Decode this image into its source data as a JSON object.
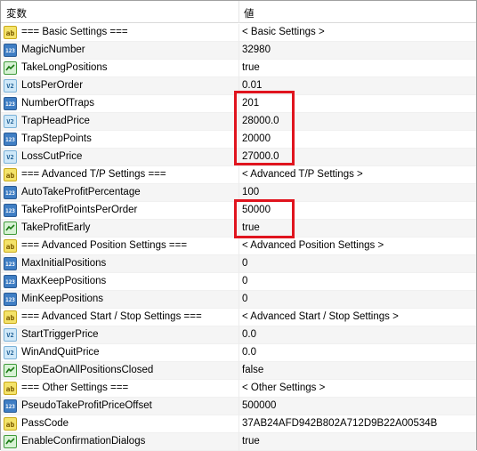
{
  "header": {
    "name_col": "変数",
    "value_col": "値"
  },
  "rows": [
    {
      "type": "ab",
      "name": "=== Basic Settings ===",
      "value": "< Basic Settings >"
    },
    {
      "type": "123",
      "name": "MagicNumber",
      "value": "32980"
    },
    {
      "type": "bool",
      "name": "TakeLongPositions",
      "value": "true"
    },
    {
      "type": "v2",
      "name": "LotsPerOrder",
      "value": "0.01"
    },
    {
      "type": "123",
      "name": "NumberOfTraps",
      "value": "201"
    },
    {
      "type": "v2",
      "name": "TrapHeadPrice",
      "value": "28000.0"
    },
    {
      "type": "123",
      "name": "TrapStepPoints",
      "value": "20000"
    },
    {
      "type": "v2",
      "name": "LossCutPrice",
      "value": "27000.0"
    },
    {
      "type": "ab",
      "name": "=== Advanced T/P Settings ===",
      "value": "< Advanced T/P Settings >"
    },
    {
      "type": "123",
      "name": "AutoTakeProfitPercentage",
      "value": "100"
    },
    {
      "type": "123",
      "name": "TakeProfitPointsPerOrder",
      "value": "50000"
    },
    {
      "type": "bool",
      "name": "TakeProfitEarly",
      "value": "true"
    },
    {
      "type": "ab",
      "name": "=== Advanced Position Settings ===",
      "value": "< Advanced Position Settings >"
    },
    {
      "type": "123",
      "name": "MaxInitialPositions",
      "value": "0"
    },
    {
      "type": "123",
      "name": "MaxKeepPositions",
      "value": "0"
    },
    {
      "type": "123",
      "name": "MinKeepPositions",
      "value": "0"
    },
    {
      "type": "ab",
      "name": "=== Advanced Start / Stop Settings ===",
      "value": "< Advanced Start / Stop Settings >"
    },
    {
      "type": "v2",
      "name": "StartTriggerPrice",
      "value": "0.0"
    },
    {
      "type": "v2",
      "name": "WinAndQuitPrice",
      "value": "0.0"
    },
    {
      "type": "bool",
      "name": "StopEaOnAllPositionsClosed",
      "value": "false"
    },
    {
      "type": "ab",
      "name": "=== Other Settings ===",
      "value": "< Other Settings >"
    },
    {
      "type": "123",
      "name": "PseudoTakeProfitPriceOffset",
      "value": "500000"
    },
    {
      "type": "ab",
      "name": "PassCode",
      "value": "37AB24AFD942B802A712D9B22A00534B"
    },
    {
      "type": "bool",
      "name": "EnableConfirmationDialogs",
      "value": "true"
    }
  ],
  "icon_labels": {
    "ab": "ab",
    "123": "123",
    "v2": "V2"
  },
  "highlight_color": "#e0141e"
}
